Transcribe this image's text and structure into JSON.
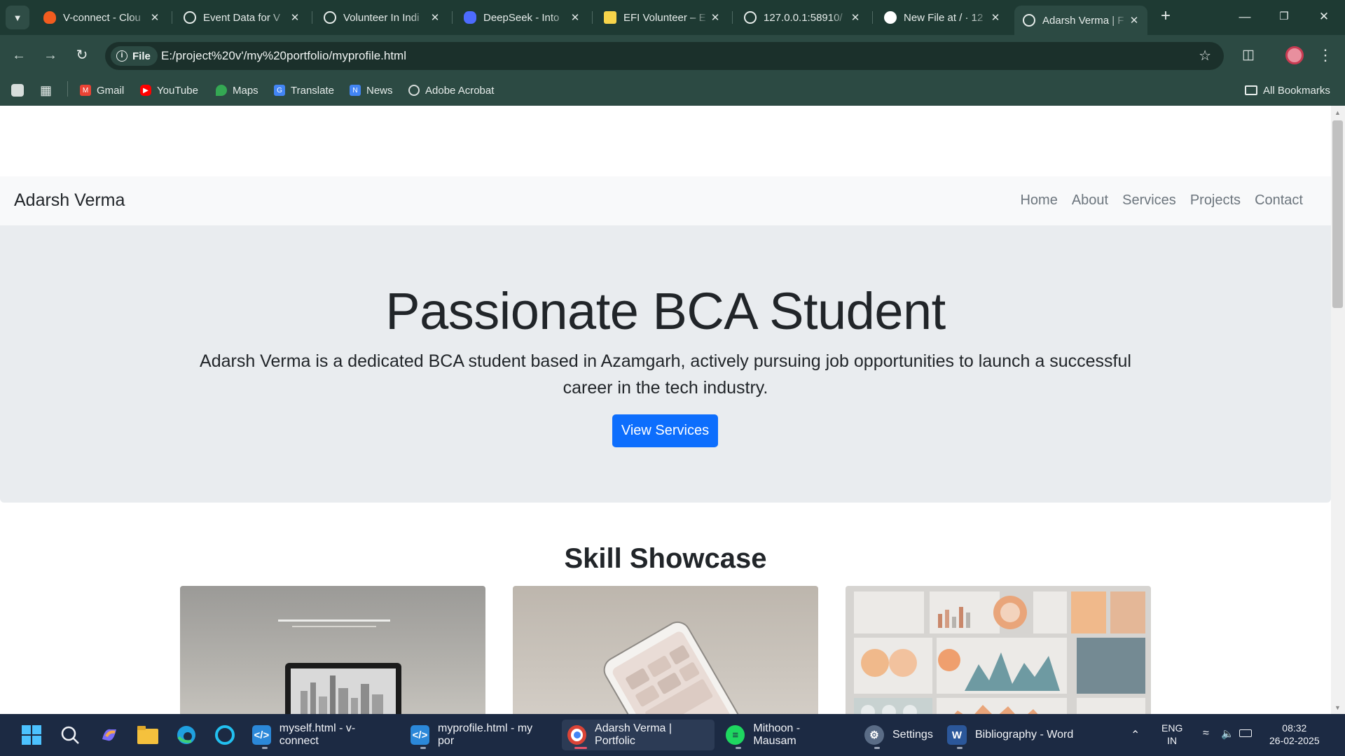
{
  "browser": {
    "tabs": [
      {
        "title": "V-connect - Clou",
        "icon": "flame-icon",
        "color": "#f25c1f"
      },
      {
        "title": "Event Data for V",
        "icon": "openai-icon",
        "color": "#e6ecea"
      },
      {
        "title": "Volunteer In Indi",
        "icon": "globe-icon",
        "color": "#e6ecea"
      },
      {
        "title": "DeepSeek - Into",
        "icon": "whale-icon",
        "color": "#4d6bfe"
      },
      {
        "title": "EFI Volunteer – E",
        "icon": "efi-icon",
        "color": "#f7d44a"
      },
      {
        "title": "127.0.0.1:58910/",
        "icon": "globe-icon",
        "color": "#e6ecea"
      },
      {
        "title": "New File at / · 12",
        "icon": "github-icon",
        "color": "#ffffff"
      },
      {
        "title": "Adarsh Verma | F",
        "icon": "globe-icon",
        "color": "#e6ecea",
        "active": true
      }
    ],
    "url_scheme_label": "File",
    "url": "E:/project%20v'/my%20portfolio/myprofile.html",
    "bookmarks": [
      {
        "label": "Gmail",
        "icon": "gmail-icon",
        "color": "#ea4335"
      },
      {
        "label": "YouTube",
        "icon": "youtube-icon",
        "color": "#ff0000"
      },
      {
        "label": "Maps",
        "icon": "maps-icon",
        "color": "#34a853"
      },
      {
        "label": "Translate",
        "icon": "translate-icon",
        "color": "#4285f4"
      },
      {
        "label": "News",
        "icon": "news-icon",
        "color": "#4285f4"
      },
      {
        "label": "Adobe Acrobat",
        "icon": "acrobat-icon",
        "color": "#d8dedc"
      }
    ],
    "all_bookmarks": "All Bookmarks"
  },
  "site": {
    "brand": "Adarsh Verma",
    "nav": [
      "Home",
      "About",
      "Services",
      "Projects",
      "Contact"
    ],
    "hero": {
      "title": "Passionate BCA Student",
      "text": "Adarsh Verma is a dedicated BCA student based in Azamgarh, actively pursuing job opportunities to launch a successful career in the tech industry.",
      "button": "View Services"
    },
    "skills_title": "Skill Showcase",
    "accent": "#0d6efd"
  },
  "taskbar": {
    "apps": [
      {
        "label": "myself.html - v-connect",
        "icon": "vscode-icon"
      },
      {
        "label": "myprofile.html - my por",
        "icon": "vscode-icon"
      },
      {
        "label": "Adarsh Verma | Portfolic",
        "icon": "chrome-icon",
        "active": true
      },
      {
        "label": "Mithoon - Mausam",
        "icon": "spotify-icon"
      },
      {
        "label": "Settings",
        "icon": "settings-icon"
      },
      {
        "label": "Bibliography - Word",
        "icon": "word-icon"
      }
    ],
    "lang": "ENG",
    "region": "IN",
    "time": "08:32",
    "date": "26-02-2025"
  }
}
